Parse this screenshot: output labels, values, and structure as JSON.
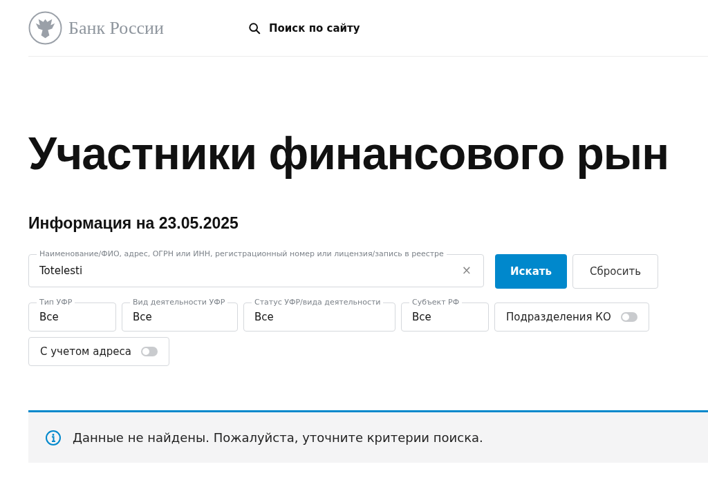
{
  "header": {
    "logo_text": "Банк России",
    "search_label": "Поиск по сайту"
  },
  "page_title": "Участники финансового рын",
  "info_date": "Информация на 23.05.2025",
  "search": {
    "label": "Наименование/ФИО, адрес, ОГРН или ИНН, регистрационный номер или лицензия/запись в реестре",
    "value": "Totelesti",
    "clear": "×"
  },
  "buttons": [
    {
      "label": "Искать",
      "kind": "primary"
    },
    {
      "label": "Сбросить",
      "kind": "secondary"
    }
  ],
  "filters": [
    {
      "kind": "select",
      "label": "Тип УФР",
      "value": "Все"
    },
    {
      "kind": "select",
      "label": "Вид деятельности УФР",
      "value": "Все"
    },
    {
      "kind": "select",
      "label": "Статус УФР/вида деятельности",
      "value": "Все"
    },
    {
      "kind": "select",
      "label": "Субъект РФ",
      "value": "Все"
    },
    {
      "kind": "toggle",
      "label": "Подразделения КО",
      "on": false
    },
    {
      "kind": "toggle",
      "label": "С учетом адреса",
      "on": false
    }
  ],
  "notice": "Данные не найдены. Пожалуйста, уточните критерии поиска."
}
